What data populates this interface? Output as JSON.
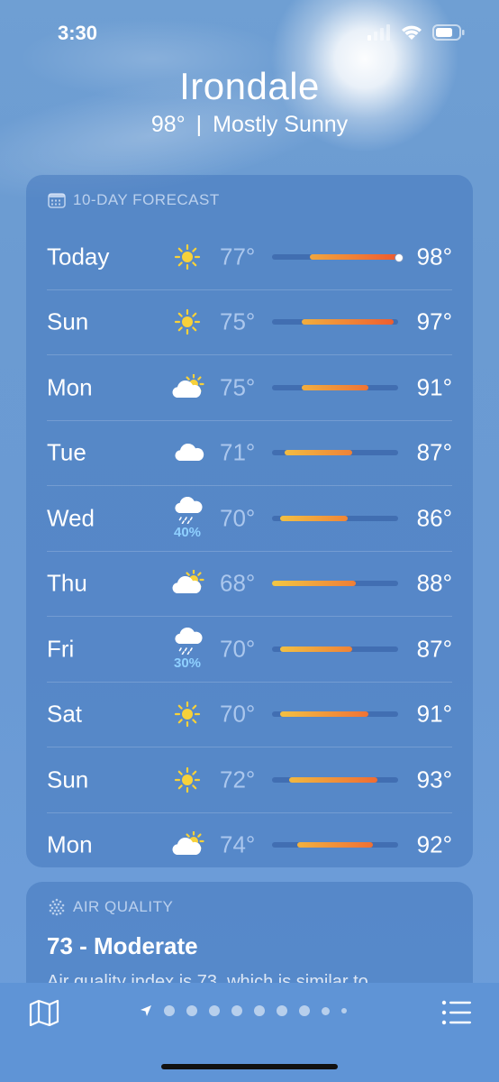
{
  "status_bar": {
    "time": "3:30"
  },
  "header": {
    "city": "Irondale",
    "current_temp": "98°",
    "separator": "|",
    "condition": "Mostly Sunny"
  },
  "forecast": {
    "title": "10-DAY FORECAST",
    "range_min": 68,
    "range_max": 98,
    "days": [
      {
        "day": "Today",
        "icon": "sun-icon",
        "low": "77°",
        "high": "98°",
        "low_val": 77,
        "high_val": 98,
        "current": 98
      },
      {
        "day": "Sun",
        "icon": "sun-icon",
        "low": "75°",
        "high": "97°",
        "low_val": 75,
        "high_val": 97
      },
      {
        "day": "Mon",
        "icon": "partly-cloudy-icon",
        "low": "75°",
        "high": "91°",
        "low_val": 75,
        "high_val": 91
      },
      {
        "day": "Tue",
        "icon": "cloud-icon",
        "low": "71°",
        "high": "87°",
        "low_val": 71,
        "high_val": 87
      },
      {
        "day": "Wed",
        "icon": "rain-cloud-icon",
        "precip": "40%",
        "low": "70°",
        "high": "86°",
        "low_val": 70,
        "high_val": 86
      },
      {
        "day": "Thu",
        "icon": "partly-cloudy-icon",
        "low": "68°",
        "high": "88°",
        "low_val": 68,
        "high_val": 88
      },
      {
        "day": "Fri",
        "icon": "rain-cloud-icon",
        "precip": "30%",
        "low": "70°",
        "high": "87°",
        "low_val": 70,
        "high_val": 87
      },
      {
        "day": "Sat",
        "icon": "sun-icon",
        "low": "70°",
        "high": "91°",
        "low_val": 70,
        "high_val": 91
      },
      {
        "day": "Sun",
        "icon": "sun-icon",
        "low": "72°",
        "high": "93°",
        "low_val": 72,
        "high_val": 93
      },
      {
        "day": "Mon",
        "icon": "partly-cloudy-icon",
        "low": "74°",
        "high": "92°",
        "low_val": 74,
        "high_val": 92
      }
    ]
  },
  "air_quality": {
    "title": "AIR QUALITY",
    "value": "73 - Moderate",
    "description": "Air quality index is 73, which is similar to"
  },
  "bottom_bar": {
    "page_count": 10,
    "active_page": 0
  },
  "colors": {
    "sun": "#f7d13a",
    "precip": "#8fd0ff",
    "bar_cool": "#f2c744",
    "bar_hot": "#ee5a2f"
  }
}
